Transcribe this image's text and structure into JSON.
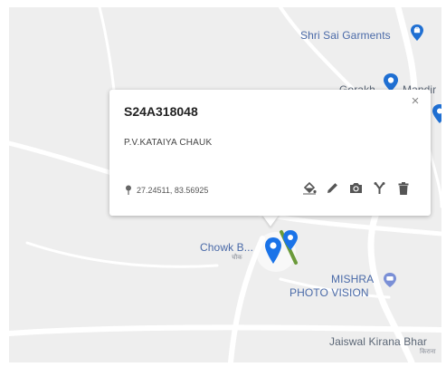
{
  "map": {
    "places": [
      {
        "label": "Shri Sai Garments",
        "icon": "shopping-bag-icon"
      },
      {
        "label": "Gorakh",
        "icon": "place-pin-icon"
      },
      {
        "label": "Mandir",
        "icon": ""
      },
      {
        "label": "Chowk B...",
        "icon": ""
      },
      {
        "label": "MISHRA",
        "icon": "camera-shop-icon"
      },
      {
        "label": "PHOTO VISION",
        "icon": ""
      },
      {
        "label": "Jaiswal Kirana Bhar",
        "icon": ""
      }
    ],
    "colors": {
      "background": "#eeeeee",
      "road": "#ffffff",
      "poi_text": "#4a6aa8",
      "poi_pin": "#1f6fd2",
      "marker_blue": "#1a73e8",
      "marker_green": "#4c8c2b"
    }
  },
  "popup": {
    "title": "S24A318048",
    "address": "P.V.KATAIYA CHAUK",
    "coordinates": "27.24511, 83.56925",
    "close_label": "×",
    "actions": [
      "paint-bucket-icon",
      "pencil-icon",
      "camera-icon",
      "fork-icon",
      "trash-icon"
    ]
  }
}
